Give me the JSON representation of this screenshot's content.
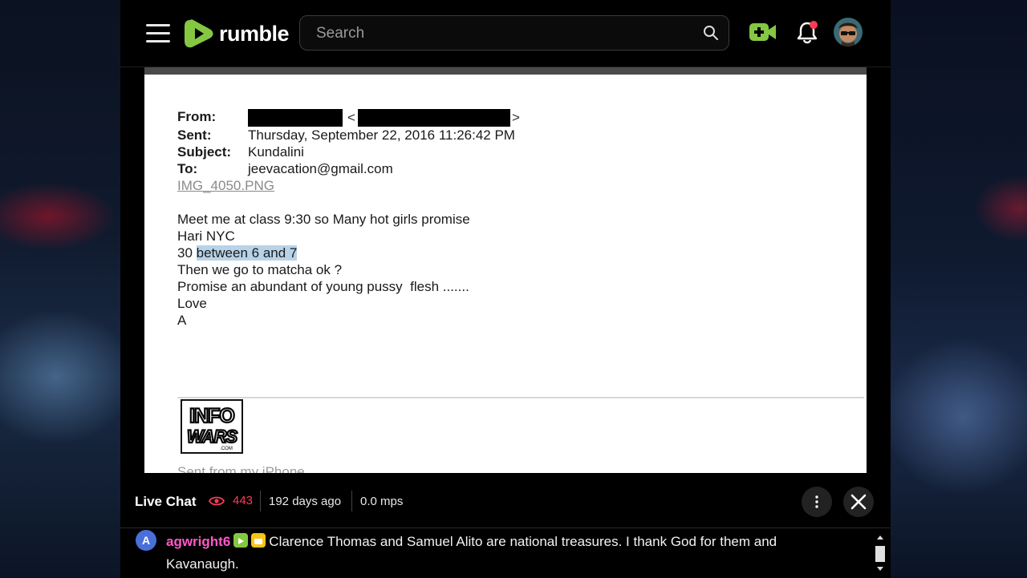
{
  "header": {
    "brand": "rumble",
    "search_placeholder": "Search"
  },
  "video": {
    "email": {
      "from_label": "From:",
      "sent_label": "Sent:",
      "subject_label": "Subject:",
      "to_label": "To:",
      "sent_value": "Thursday, September 22, 2016 11:26:42 PM",
      "subject_value": "Kundalini",
      "to_value": "jeevacation@gmail.com",
      "attachment": "IMG_4050.PNG",
      "line1": "Meet me at class 9:30 so Many hot girls promise",
      "line2": "Hari NYC",
      "line3_pre": "30 ",
      "line3_highlight": "between 6 and 7",
      "line4": "Then we go to matcha ok ?",
      "line5": "Promise an abundant of young pussy  flesh .......",
      "line6": "Love",
      "line7": "A",
      "logo_text_top": "INFO",
      "logo_text_bottom": "WARS",
      "footer_cut": "Sent from my iPhone"
    }
  },
  "chat": {
    "title": "Live Chat",
    "viewers": "443",
    "age": "192 days ago",
    "rate": "0.0 mps",
    "messages": [
      {
        "avatar_letter": "A",
        "username": "agwright6",
        "text": "Clarence Thomas and Samuel Alito are national treasures. I thank God for them and Kavanaugh."
      }
    ]
  },
  "colors": {
    "brand_green": "#85c742",
    "viewer_red": "#ff3b55",
    "username_pink": "#ff59c8",
    "highlight_blue": "#b8d3e8"
  }
}
